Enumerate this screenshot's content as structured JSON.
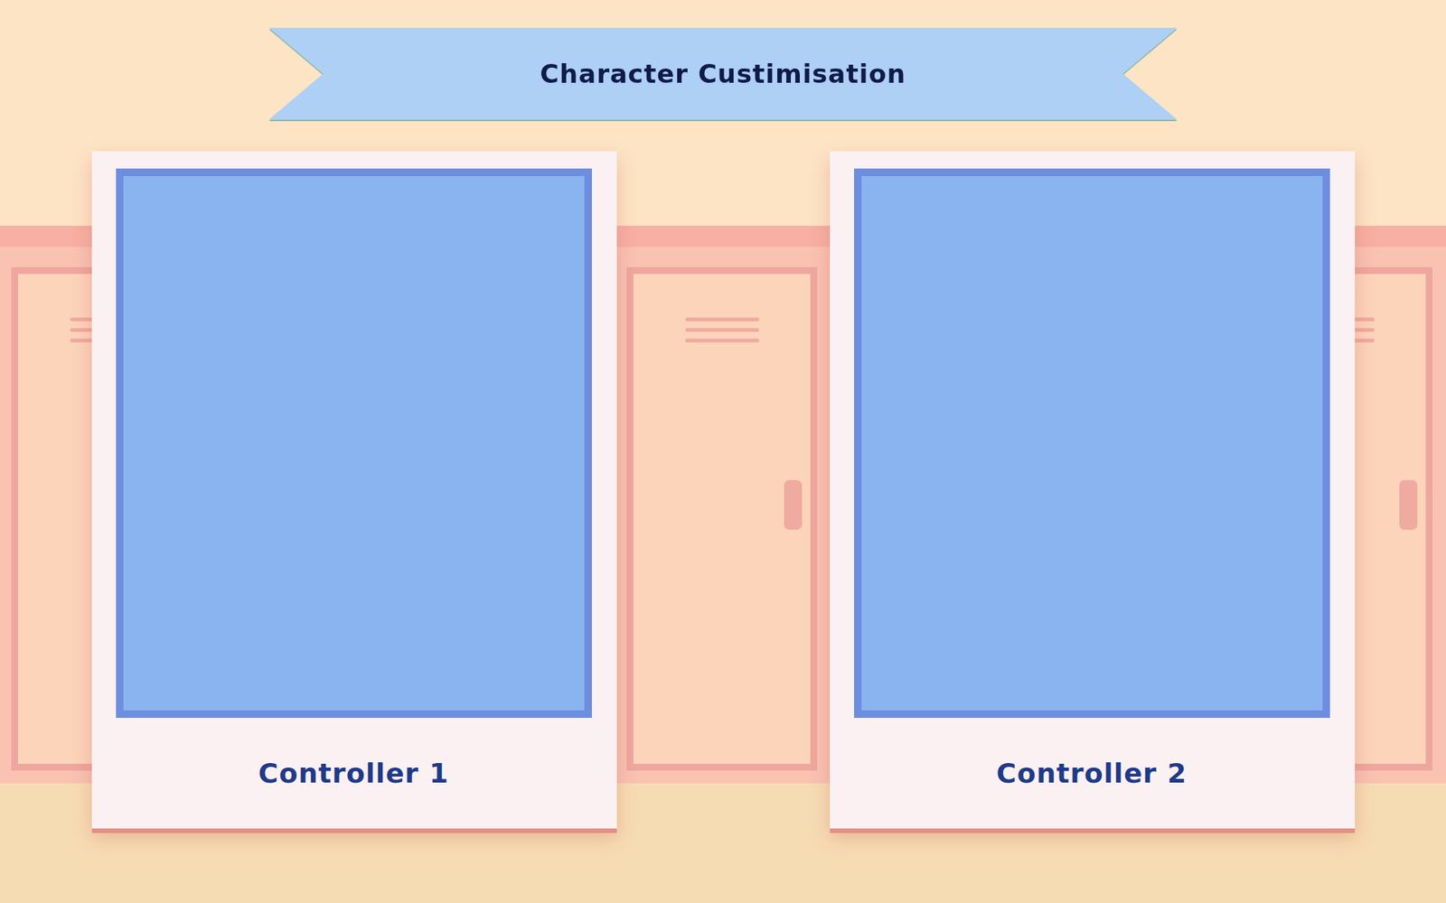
{
  "title": "Character Custimisation",
  "players": [
    {
      "label": "Controller 1"
    },
    {
      "label": "Controller 2"
    }
  ]
}
